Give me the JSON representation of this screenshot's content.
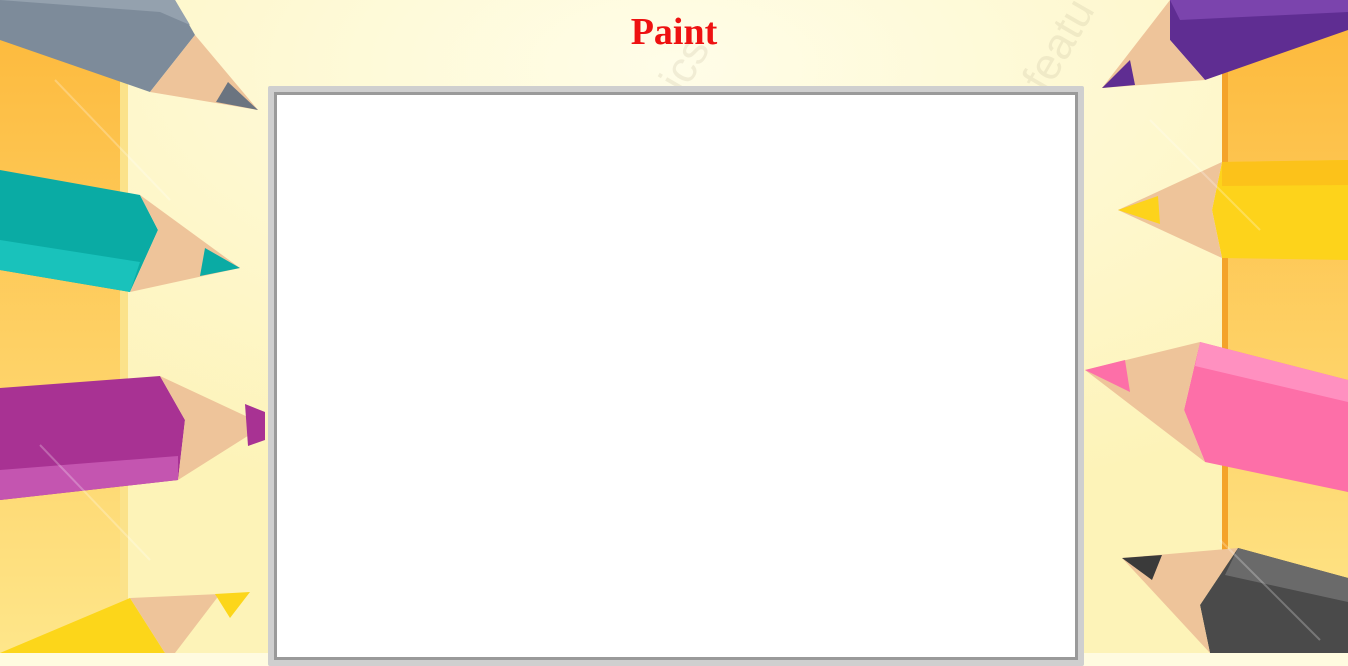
{
  "title": "Paint",
  "colors": {
    "title": "#ee1111",
    "background": "#fffbe0",
    "side_panel": "#fcc84a",
    "canvas": "#ffffff",
    "canvas_border": "#9a9a9a"
  },
  "pencils": [
    {
      "name": "gray-pencil-icon",
      "color": "#7d8b9a"
    },
    {
      "name": "teal-pencil-icon",
      "color": "#0aaba4"
    },
    {
      "name": "magenta-pencil-icon",
      "color": "#a83293"
    },
    {
      "name": "yellow-pencil-icon",
      "color": "#fcd61a"
    },
    {
      "name": "purple-pencil-icon",
      "color": "#5f2d92"
    },
    {
      "name": "orange-yellow-pencil-icon",
      "color": "#fdd31b"
    },
    {
      "name": "pink-pencil-icon",
      "color": "#fd6fa8"
    },
    {
      "name": "black-pencil-icon",
      "color": "#4a4a4a"
    }
  ]
}
